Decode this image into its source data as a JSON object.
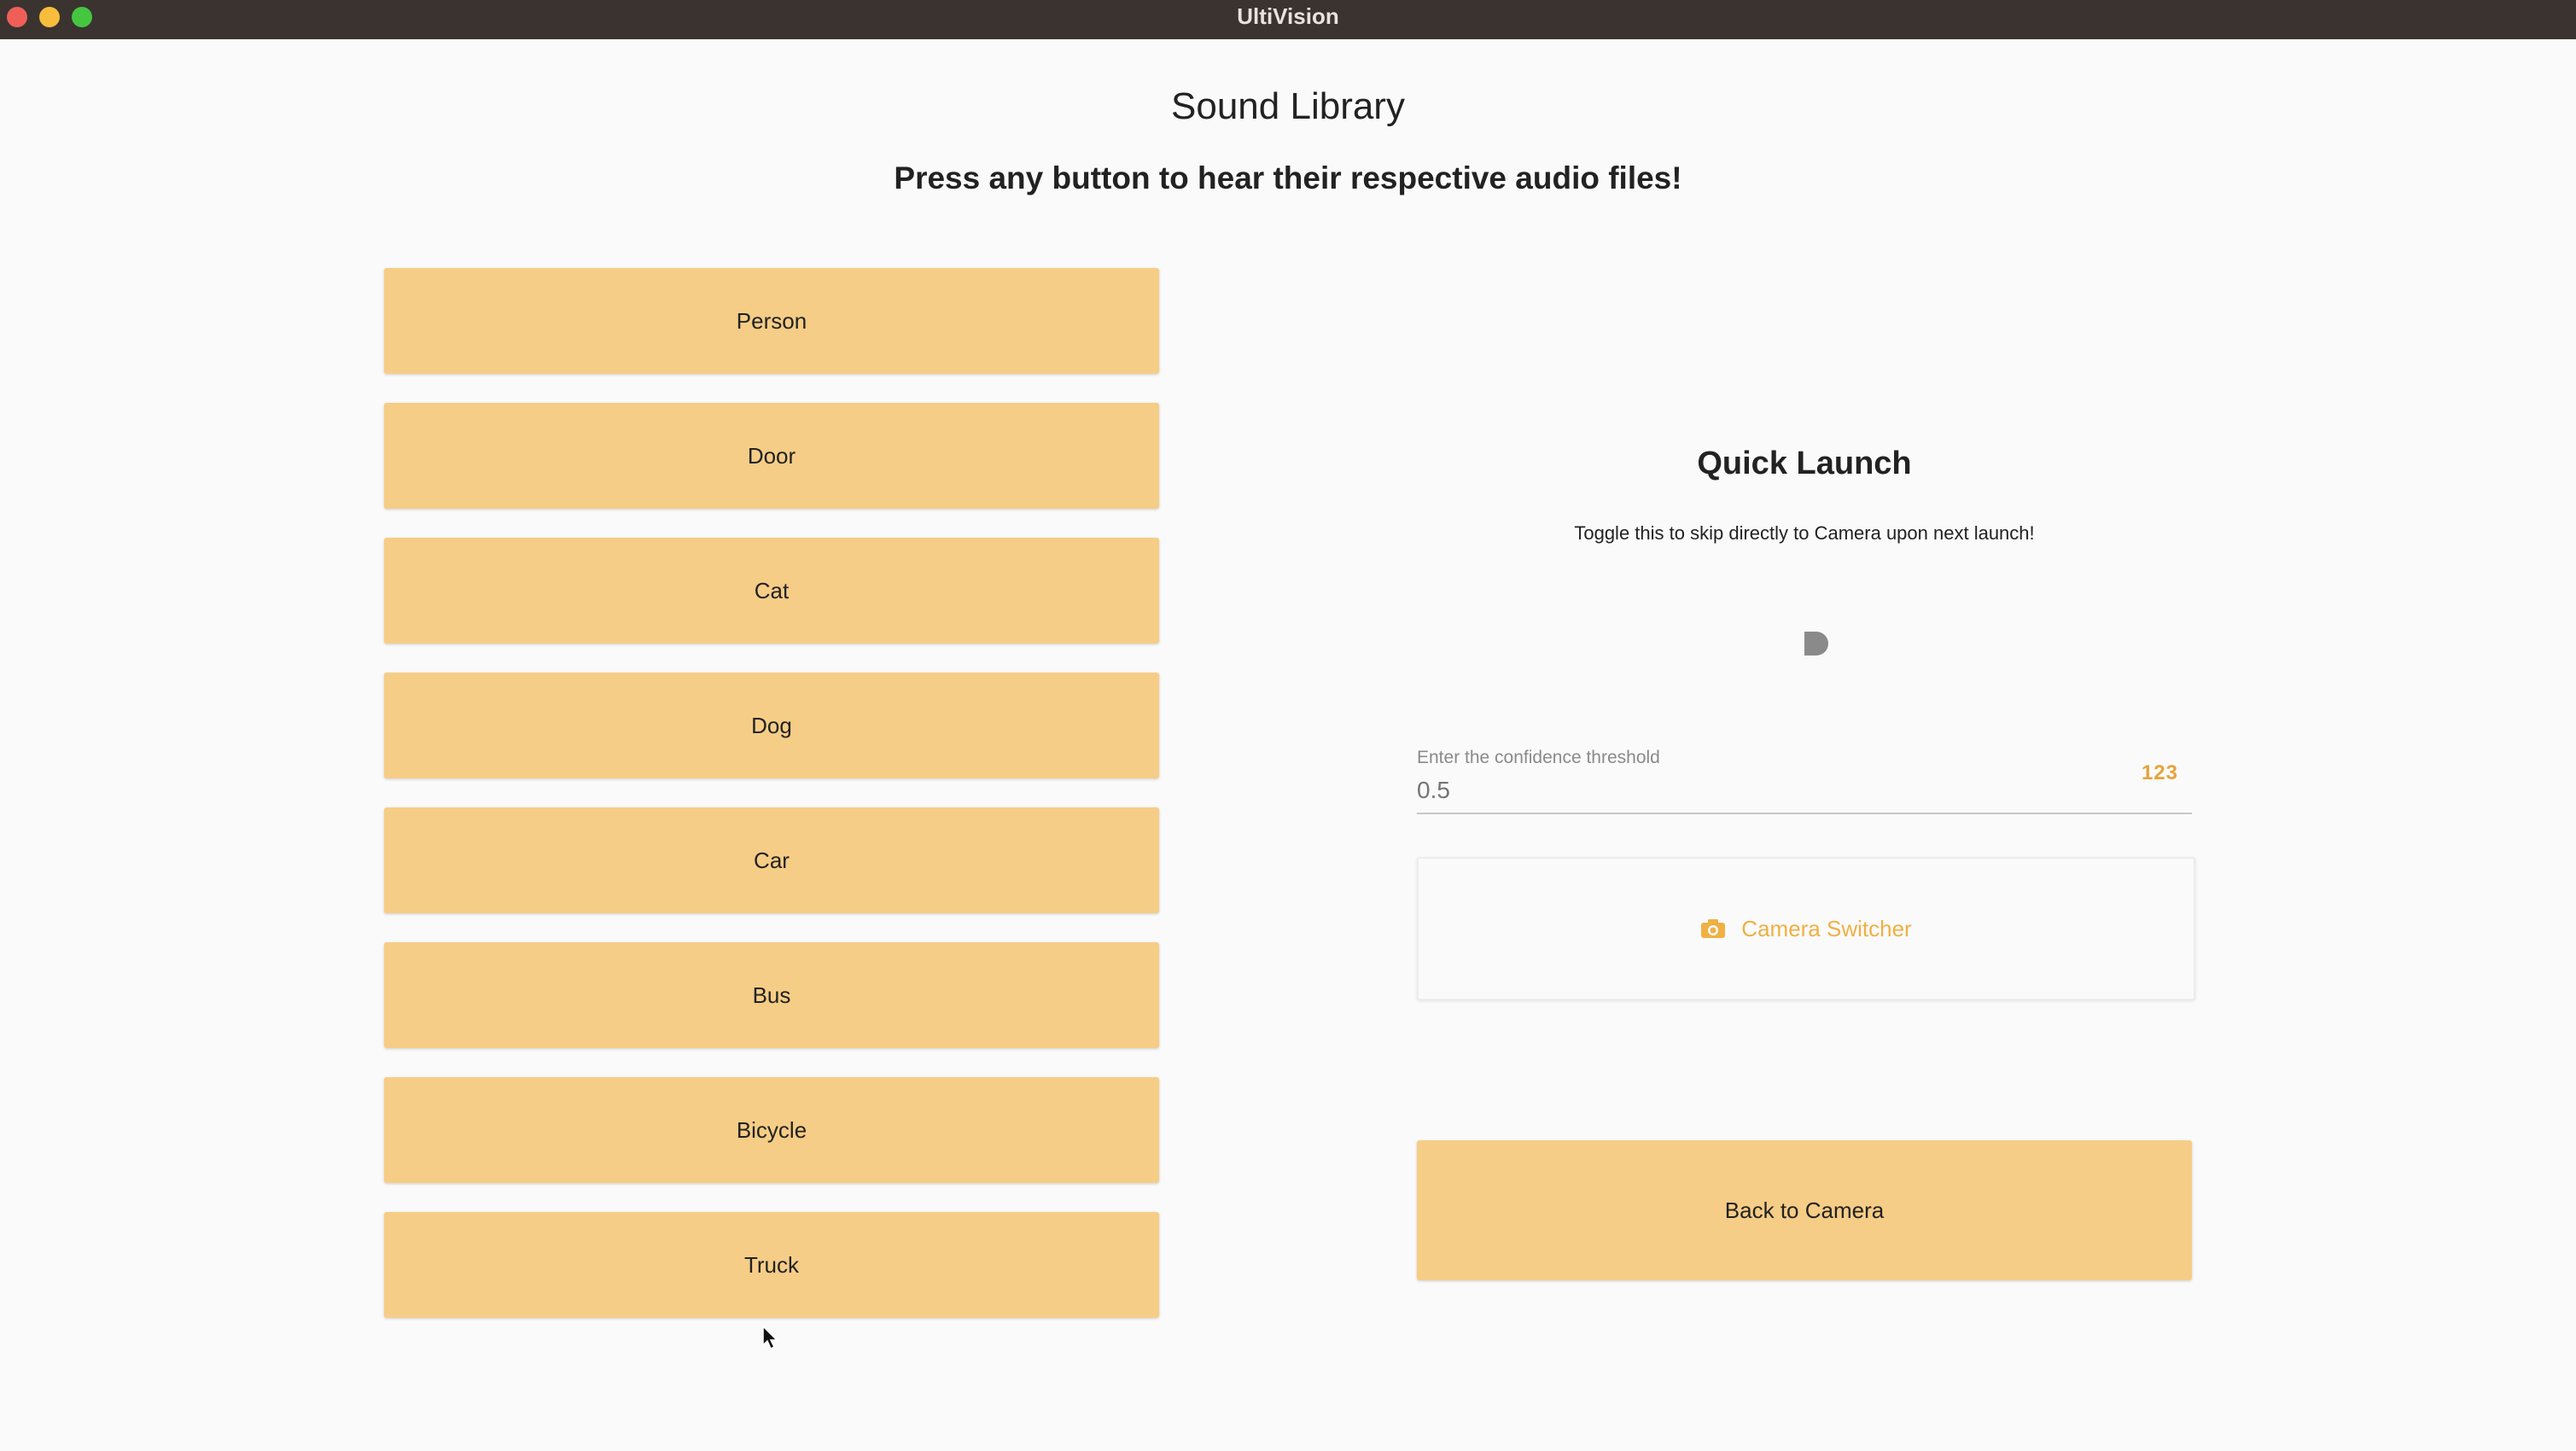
{
  "window": {
    "title": "UltiVision"
  },
  "header": {
    "title": "Sound Library",
    "subtitle": "Press any button to hear their respective audio files!"
  },
  "sounds": [
    {
      "label": "Person"
    },
    {
      "label": "Door"
    },
    {
      "label": "Cat"
    },
    {
      "label": "Dog"
    },
    {
      "label": "Car"
    },
    {
      "label": "Bus"
    },
    {
      "label": "Bicycle"
    },
    {
      "label": "Truck"
    }
  ],
  "quick_launch": {
    "title": "Quick Launch",
    "description": "Toggle this to skip directly to Camera upon next launch!",
    "toggle_on": false
  },
  "confidence": {
    "label": "Enter the confidence threshold",
    "placeholder": "0.5",
    "value": "",
    "keyboard_icon": "123"
  },
  "camera_switcher": {
    "label": "Camera Switcher",
    "icon": "camera-icon"
  },
  "back_button": {
    "label": "Back to Camera"
  },
  "colors": {
    "button_fill": "#f6cd86",
    "accent": "#f0b043",
    "titlebar": "#3a3330"
  }
}
